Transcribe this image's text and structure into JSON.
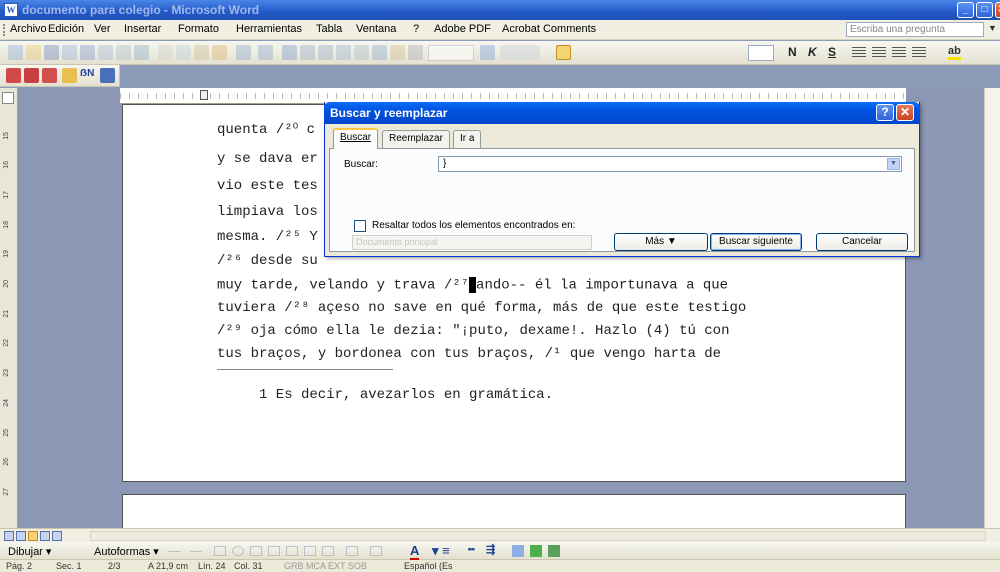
{
  "window": {
    "title": "documento para colegio - Microsoft Word",
    "app_icon": "W"
  },
  "menu": {
    "items": [
      "Archivo",
      "Edición",
      "Ver",
      "Insertar",
      "Formato",
      "Herramientas",
      "Tabla",
      "Ventana",
      "?",
      "Adobe PDF",
      "Acrobat Comments"
    ],
    "help_placeholder": "Escriba una pregunta"
  },
  "toolbar": {
    "bold": "N",
    "italic": "K",
    "underline": "S",
    "highlight_glyph": "ab"
  },
  "toolbar2": {
    "fx_label": "ẞN"
  },
  "ruler": {
    "vertical": [
      "15",
      "16",
      "17",
      "18",
      "19",
      "20",
      "21",
      "22",
      "23",
      "24",
      "25",
      "26",
      "27"
    ]
  },
  "document": {
    "lines": [
      "quenta /²⁰ c",
      "y se dava er",
      "vio este tes",
      "limpiava los",
      "mesma. /²⁵ Y",
      "/²⁶ desde su",
      "muy tarde, velando y trava /²⁷ ando-- él la importunava a que",
      "tuviera /²⁸ açeso no save en qué forma, más de que este testigo",
      "/²⁹ oja cómo ella le dezia: \"¡puto, dexame!. Hazlo (4) tú con",
      "tus braços, y bordonea con tus braços, /¹ que vengo harta de"
    ],
    "line_7_before": "muy tarde, velando y trava /²⁷",
    "line_7_after": "ando-- él la importunava a que",
    "footnote": "1 Es decir, avezarlos en gramática."
  },
  "dialog": {
    "title": "Buscar y reemplazar",
    "help_glyph": "?",
    "close_glyph": "✕",
    "tabs": [
      "Buscar",
      "Reemplazar",
      "Ir a"
    ],
    "search_label": "Buscar:",
    "search_value": "}",
    "highlight_label": "Resaltar todos los elementos encontrados en:",
    "scope_value": "Documento principal",
    "more_button": "Más ▼",
    "find_next_button": "Buscar siguiente",
    "cancel_button": "Cancelar"
  },
  "drawing": {
    "draw_label": "Dibujar ▾",
    "autoshapes_label": "Autoformas ▾",
    "font_color_glyph": "A"
  },
  "status": {
    "page": "Pág. 2",
    "section": "Sec. 1",
    "pages": "2/3",
    "position": "A 21,9 cm",
    "line": "Lín. 24",
    "column": "Col. 31",
    "modes": "GRB  MCA  EXT  SOB",
    "language": "Español (Es"
  },
  "colors": {
    "titlebar": "#2358C8",
    "dialog_title": "#0052E0",
    "page_bg": "#FFFFFF",
    "workspace": "#8B97B5",
    "tab_accent": "#FFC83C"
  }
}
